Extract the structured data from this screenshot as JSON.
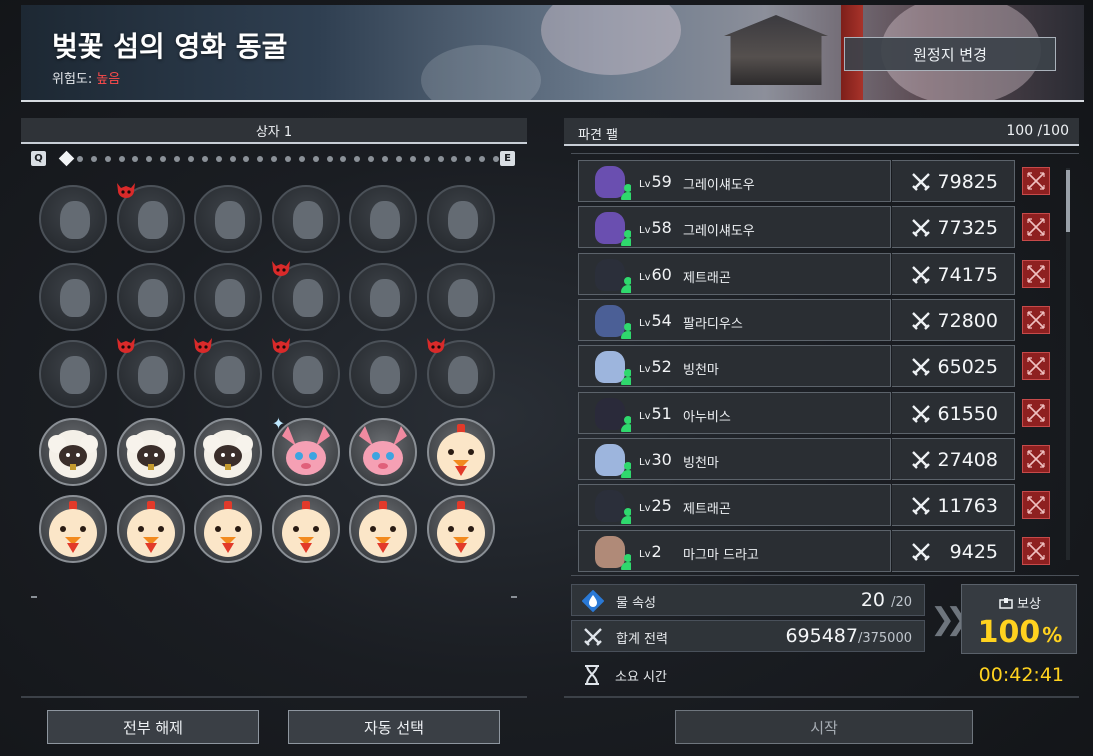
{
  "header": {
    "title": "벚꽃 섬의 영화 동굴",
    "danger_label": "위험도:",
    "danger_value": "높음",
    "change_button": "원정지 변경"
  },
  "box": {
    "title": "상자 1",
    "prev_key": "Q",
    "next_key": "E",
    "page_count": 32,
    "current_page": 1
  },
  "slots": [
    {
      "type": "empty",
      "marker": ""
    },
    {
      "type": "empty",
      "marker": "demon"
    },
    {
      "type": "empty",
      "marker": ""
    },
    {
      "type": "empty",
      "marker": ""
    },
    {
      "type": "empty",
      "marker": ""
    },
    {
      "type": "empty",
      "marker": ""
    },
    {
      "type": "empty",
      "marker": ""
    },
    {
      "type": "empty",
      "marker": ""
    },
    {
      "type": "empty",
      "marker": ""
    },
    {
      "type": "empty",
      "marker": "demon"
    },
    {
      "type": "empty",
      "marker": ""
    },
    {
      "type": "empty",
      "marker": ""
    },
    {
      "type": "empty",
      "marker": ""
    },
    {
      "type": "empty",
      "marker": "demon"
    },
    {
      "type": "empty",
      "marker": "demon"
    },
    {
      "type": "empty",
      "marker": "demon"
    },
    {
      "type": "empty",
      "marker": ""
    },
    {
      "type": "empty",
      "marker": "demon"
    },
    {
      "type": "sheep",
      "marker": ""
    },
    {
      "type": "sheep",
      "marker": ""
    },
    {
      "type": "sheep",
      "marker": ""
    },
    {
      "type": "pink",
      "marker": "sparkle"
    },
    {
      "type": "pink",
      "marker": ""
    },
    {
      "type": "chick",
      "marker": ""
    },
    {
      "type": "chick",
      "marker": ""
    },
    {
      "type": "chick",
      "marker": ""
    },
    {
      "type": "chick",
      "marker": ""
    },
    {
      "type": "chick",
      "marker": ""
    },
    {
      "type": "chick",
      "marker": ""
    },
    {
      "type": "chick",
      "marker": ""
    }
  ],
  "buttons": {
    "release_all": "전부 해제",
    "auto_select": "자동 선택",
    "start": "시작"
  },
  "team": {
    "title": "파견 팰",
    "count": "100 /100",
    "pals": [
      {
        "lv_prefix": "Lv",
        "level": "59",
        "name": "그레이섀도우",
        "power": "79825",
        "color": "#6a4fb0"
      },
      {
        "lv_prefix": "Lv",
        "level": "58",
        "name": "그레이섀도우",
        "power": "77325",
        "color": "#6a4fb0"
      },
      {
        "lv_prefix": "Lv",
        "level": "60",
        "name": "제트래곤",
        "power": "74175",
        "color": "#2b2f3a"
      },
      {
        "lv_prefix": "Lv",
        "level": "54",
        "name": "팔라디우스",
        "power": "72800",
        "color": "#4b5f96"
      },
      {
        "lv_prefix": "Lv",
        "level": "52",
        "name": "빙천마",
        "power": "65025",
        "color": "#9db5dd"
      },
      {
        "lv_prefix": "Lv",
        "level": "51",
        "name": "아누비스",
        "power": "61550",
        "color": "#2a2a3a"
      },
      {
        "lv_prefix": "Lv",
        "level": "30",
        "name": "빙천마",
        "power": "27408",
        "color": "#9db5dd"
      },
      {
        "lv_prefix": "Lv",
        "level": "25",
        "name": "제트래곤",
        "power": "11763",
        "color": "#2b2f3a"
      },
      {
        "lv_prefix": "Lv",
        "level": "2",
        "name": "마그마 드라고",
        "power": "9425",
        "color": "#b08a78"
      }
    ]
  },
  "stats": {
    "element_label": "물 속성",
    "element_value": "20",
    "element_max": "/20",
    "power_label": "합계 전력",
    "power_value": "695487",
    "power_required": "/375000",
    "time_label": "소요 시간",
    "time_value": "00:42:41"
  },
  "reward": {
    "label": "보상",
    "value": "100",
    "unit": "%"
  },
  "colors": {
    "accent_yellow": "#ffd21f",
    "danger_red": "#ff4b4b",
    "remove_red": "#8e2020",
    "presence_green": "#2fd86d"
  }
}
